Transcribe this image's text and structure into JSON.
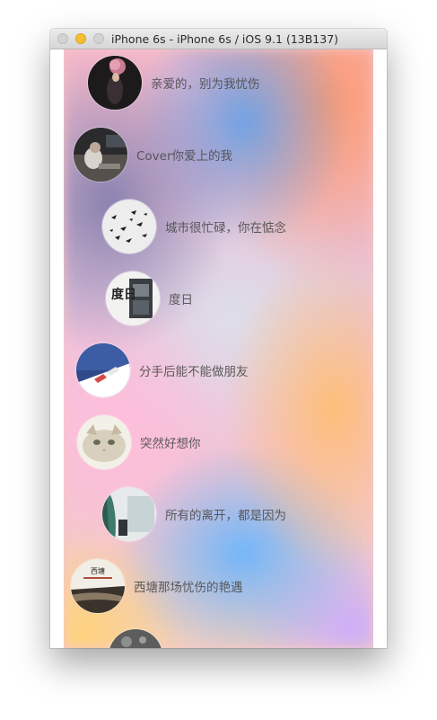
{
  "window": {
    "title": "iPhone 6s - iPhone 6s / iOS 9.1 (13B137)"
  },
  "songs": [
    {
      "title": "亲爱的，别为我忧伤"
    },
    {
      "title": "Cover你爱上的我"
    },
    {
      "title": "城市很忙碌，你在惦念"
    },
    {
      "title": "度日"
    },
    {
      "title": "分手后能不能做朋友"
    },
    {
      "title": "突然好想你"
    },
    {
      "title": "所有的离开，都是因为"
    },
    {
      "title": "西塘那场忧伤的艳遇"
    },
    {
      "title": ""
    }
  ],
  "art": {
    "avatar_text": {
      "du_ri": "度日",
      "xi_tang": "西塘"
    }
  }
}
